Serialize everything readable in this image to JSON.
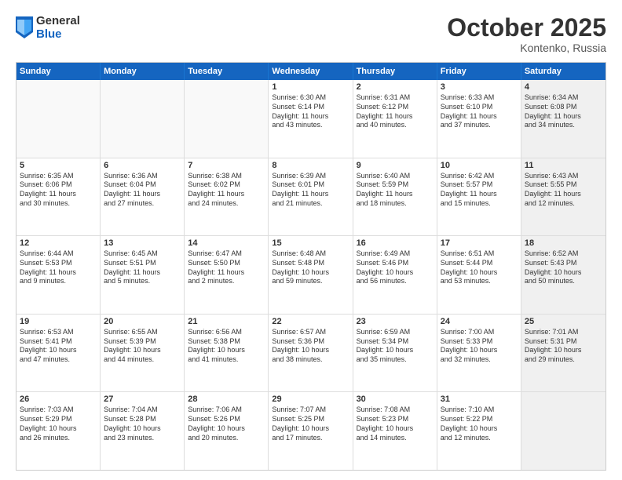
{
  "header": {
    "logo_general": "General",
    "logo_blue": "Blue",
    "month_title": "October 2025",
    "location": "Kontenko, Russia"
  },
  "days_of_week": [
    "Sunday",
    "Monday",
    "Tuesday",
    "Wednesday",
    "Thursday",
    "Friday",
    "Saturday"
  ],
  "weeks": [
    [
      {
        "day": "",
        "text": "",
        "empty": true
      },
      {
        "day": "",
        "text": "",
        "empty": true
      },
      {
        "day": "",
        "text": "",
        "empty": true
      },
      {
        "day": "1",
        "text": "Sunrise: 6:30 AM\nSunset: 6:14 PM\nDaylight: 11 hours\nand 43 minutes.",
        "empty": false
      },
      {
        "day": "2",
        "text": "Sunrise: 6:31 AM\nSunset: 6:12 PM\nDaylight: 11 hours\nand 40 minutes.",
        "empty": false
      },
      {
        "day": "3",
        "text": "Sunrise: 6:33 AM\nSunset: 6:10 PM\nDaylight: 11 hours\nand 37 minutes.",
        "empty": false
      },
      {
        "day": "4",
        "text": "Sunrise: 6:34 AM\nSunset: 6:08 PM\nDaylight: 11 hours\nand 34 minutes.",
        "empty": false,
        "shaded": true
      }
    ],
    [
      {
        "day": "5",
        "text": "Sunrise: 6:35 AM\nSunset: 6:06 PM\nDaylight: 11 hours\nand 30 minutes.",
        "empty": false
      },
      {
        "day": "6",
        "text": "Sunrise: 6:36 AM\nSunset: 6:04 PM\nDaylight: 11 hours\nand 27 minutes.",
        "empty": false
      },
      {
        "day": "7",
        "text": "Sunrise: 6:38 AM\nSunset: 6:02 PM\nDaylight: 11 hours\nand 24 minutes.",
        "empty": false
      },
      {
        "day": "8",
        "text": "Sunrise: 6:39 AM\nSunset: 6:01 PM\nDaylight: 11 hours\nand 21 minutes.",
        "empty": false
      },
      {
        "day": "9",
        "text": "Sunrise: 6:40 AM\nSunset: 5:59 PM\nDaylight: 11 hours\nand 18 minutes.",
        "empty": false
      },
      {
        "day": "10",
        "text": "Sunrise: 6:42 AM\nSunset: 5:57 PM\nDaylight: 11 hours\nand 15 minutes.",
        "empty": false
      },
      {
        "day": "11",
        "text": "Sunrise: 6:43 AM\nSunset: 5:55 PM\nDaylight: 11 hours\nand 12 minutes.",
        "empty": false,
        "shaded": true
      }
    ],
    [
      {
        "day": "12",
        "text": "Sunrise: 6:44 AM\nSunset: 5:53 PM\nDaylight: 11 hours\nand 9 minutes.",
        "empty": false
      },
      {
        "day": "13",
        "text": "Sunrise: 6:45 AM\nSunset: 5:51 PM\nDaylight: 11 hours\nand 5 minutes.",
        "empty": false
      },
      {
        "day": "14",
        "text": "Sunrise: 6:47 AM\nSunset: 5:50 PM\nDaylight: 11 hours\nand 2 minutes.",
        "empty": false
      },
      {
        "day": "15",
        "text": "Sunrise: 6:48 AM\nSunset: 5:48 PM\nDaylight: 10 hours\nand 59 minutes.",
        "empty": false
      },
      {
        "day": "16",
        "text": "Sunrise: 6:49 AM\nSunset: 5:46 PM\nDaylight: 10 hours\nand 56 minutes.",
        "empty": false
      },
      {
        "day": "17",
        "text": "Sunrise: 6:51 AM\nSunset: 5:44 PM\nDaylight: 10 hours\nand 53 minutes.",
        "empty": false
      },
      {
        "day": "18",
        "text": "Sunrise: 6:52 AM\nSunset: 5:43 PM\nDaylight: 10 hours\nand 50 minutes.",
        "empty": false,
        "shaded": true
      }
    ],
    [
      {
        "day": "19",
        "text": "Sunrise: 6:53 AM\nSunset: 5:41 PM\nDaylight: 10 hours\nand 47 minutes.",
        "empty": false
      },
      {
        "day": "20",
        "text": "Sunrise: 6:55 AM\nSunset: 5:39 PM\nDaylight: 10 hours\nand 44 minutes.",
        "empty": false
      },
      {
        "day": "21",
        "text": "Sunrise: 6:56 AM\nSunset: 5:38 PM\nDaylight: 10 hours\nand 41 minutes.",
        "empty": false
      },
      {
        "day": "22",
        "text": "Sunrise: 6:57 AM\nSunset: 5:36 PM\nDaylight: 10 hours\nand 38 minutes.",
        "empty": false
      },
      {
        "day": "23",
        "text": "Sunrise: 6:59 AM\nSunset: 5:34 PM\nDaylight: 10 hours\nand 35 minutes.",
        "empty": false
      },
      {
        "day": "24",
        "text": "Sunrise: 7:00 AM\nSunset: 5:33 PM\nDaylight: 10 hours\nand 32 minutes.",
        "empty": false
      },
      {
        "day": "25",
        "text": "Sunrise: 7:01 AM\nSunset: 5:31 PM\nDaylight: 10 hours\nand 29 minutes.",
        "empty": false,
        "shaded": true
      }
    ],
    [
      {
        "day": "26",
        "text": "Sunrise: 7:03 AM\nSunset: 5:29 PM\nDaylight: 10 hours\nand 26 minutes.",
        "empty": false
      },
      {
        "day": "27",
        "text": "Sunrise: 7:04 AM\nSunset: 5:28 PM\nDaylight: 10 hours\nand 23 minutes.",
        "empty": false
      },
      {
        "day": "28",
        "text": "Sunrise: 7:06 AM\nSunset: 5:26 PM\nDaylight: 10 hours\nand 20 minutes.",
        "empty": false
      },
      {
        "day": "29",
        "text": "Sunrise: 7:07 AM\nSunset: 5:25 PM\nDaylight: 10 hours\nand 17 minutes.",
        "empty": false
      },
      {
        "day": "30",
        "text": "Sunrise: 7:08 AM\nSunset: 5:23 PM\nDaylight: 10 hours\nand 14 minutes.",
        "empty": false
      },
      {
        "day": "31",
        "text": "Sunrise: 7:10 AM\nSunset: 5:22 PM\nDaylight: 10 hours\nand 12 minutes.",
        "empty": false
      },
      {
        "day": "",
        "text": "",
        "empty": true,
        "shaded": true
      }
    ]
  ]
}
